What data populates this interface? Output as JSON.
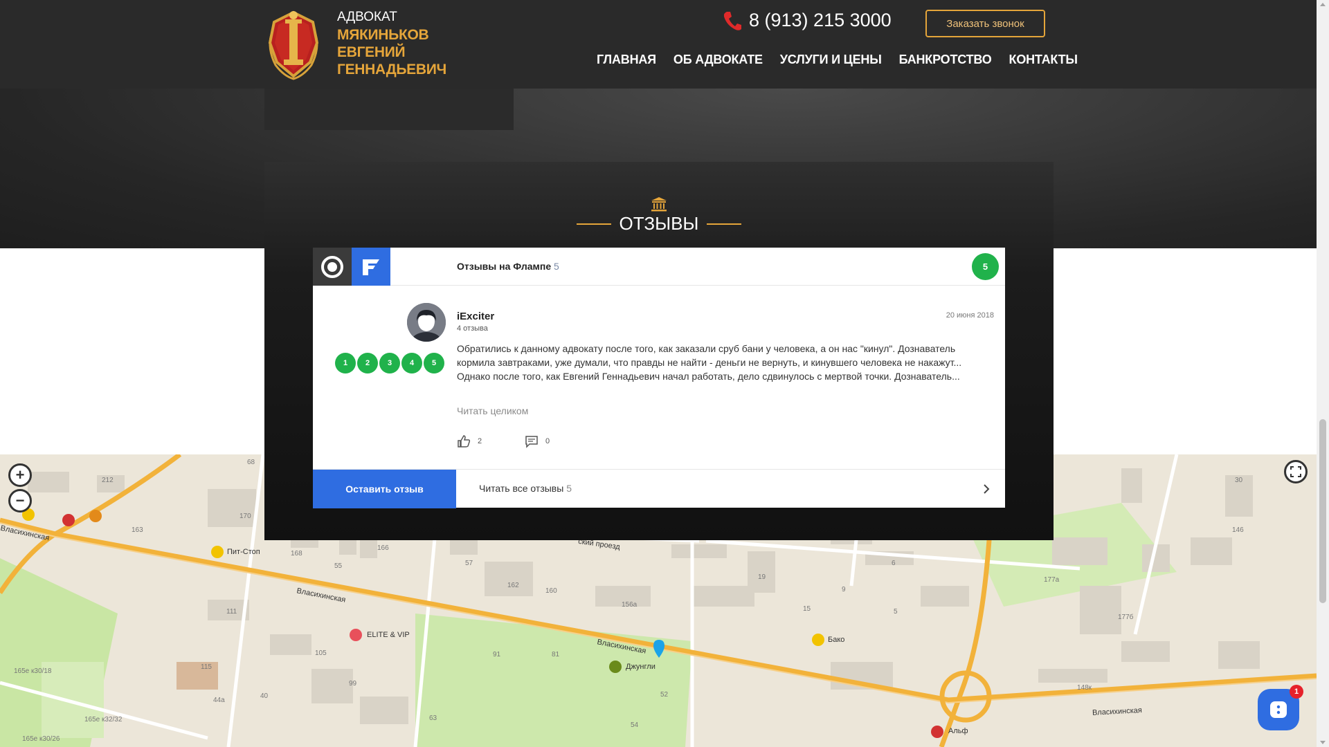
{
  "header": {
    "logo_small": "АДВОКАТ",
    "logo_name_lines": [
      "МЯКИНЬКОВ",
      "ЕВГЕНИЙ",
      "ГЕННАДЬЕВИЧ"
    ],
    "phone": "8 (913) 215 3000",
    "callback_label": "Заказать звонок",
    "nav": [
      "ГЛАВНАЯ",
      "ОБ АДВОКАТЕ",
      "УСЛУГИ И ЦЕНЫ",
      "БАНКРОТСТВО",
      "КОНТАКТЫ"
    ]
  },
  "reviews": {
    "title": "ОТЗЫВЫ",
    "widget": {
      "title": "Отзывы на Флампе",
      "title_count": "5",
      "rating": "5",
      "review": {
        "author": "iExciter",
        "author_reviews": "4 отзыва",
        "date": "20 июня 2018",
        "scores": [
          "1",
          "2",
          "3",
          "4",
          "5"
        ],
        "text": "Обратились к данному адвокату после того, как заказали сруб бани у человека, а он нас \"кинул\". Дознаватель кормила завтраками, уже думали, что правды не найти - деньги не вернуть, и кинувшего человека не накажут... Однако после того, как Евгений Геннадьевич начал работать, дело сдвинулось с мертвой точки. Дознаватель...",
        "read_more": "Читать целиком",
        "likes": "2",
        "comments": "0"
      },
      "leave_review": "Оставить отзыв",
      "read_all": "Читать все отзывы",
      "read_all_count": "5"
    }
  },
  "map": {
    "labels": {
      "pit_stop": "Пит-Стоп",
      "elite_vip": "ELITE & VIP",
      "dzhungli": "Джунгли",
      "bako": "Бако",
      "alf": "Альф",
      "vlasikhinskaya_1": "Власихинская",
      "vlasikhinskaya_2": "Власихинская",
      "vlasikhinskaya_3": "Власихинская",
      "vlasikhinskaya_4": "Власихинская",
      "proezd": "ский проезд",
      "h212": "212",
      "h170": "170",
      "h168": "168",
      "h166": "166",
      "h162": "162",
      "h160": "160",
      "h156a": "156а",
      "h111": "111",
      "h115": "115",
      "h105": "105",
      "h99": "99",
      "h91": "91",
      "h81": "81",
      "h57": "57",
      "h55": "55",
      "h5": "5",
      "h15": "15",
      "h6": "6",
      "h9": "9",
      "h19": "19",
      "h146": "146",
      "h1776": "177б",
      "h177a": "177а",
      "h30": "30",
      "h68": "68",
      "h163": "163",
      "h44a": "44а",
      "h40": "40",
      "h52": "52",
      "h54": "54",
      "h63": "63",
      "h165e3018": "165е к30/18",
      "h165e3232": "165е к32/32",
      "h165e3026": "165е к30/26",
      "h148k": "148к"
    },
    "zoom_in": "+",
    "zoom_out": "−"
  },
  "chat": {
    "badge": "1"
  },
  "colors": {
    "accent_gold": "#e5a53a",
    "header_bg": "#2a2a2a",
    "flamp_blue": "#2f6de1",
    "rating_green": "#20b24b"
  }
}
